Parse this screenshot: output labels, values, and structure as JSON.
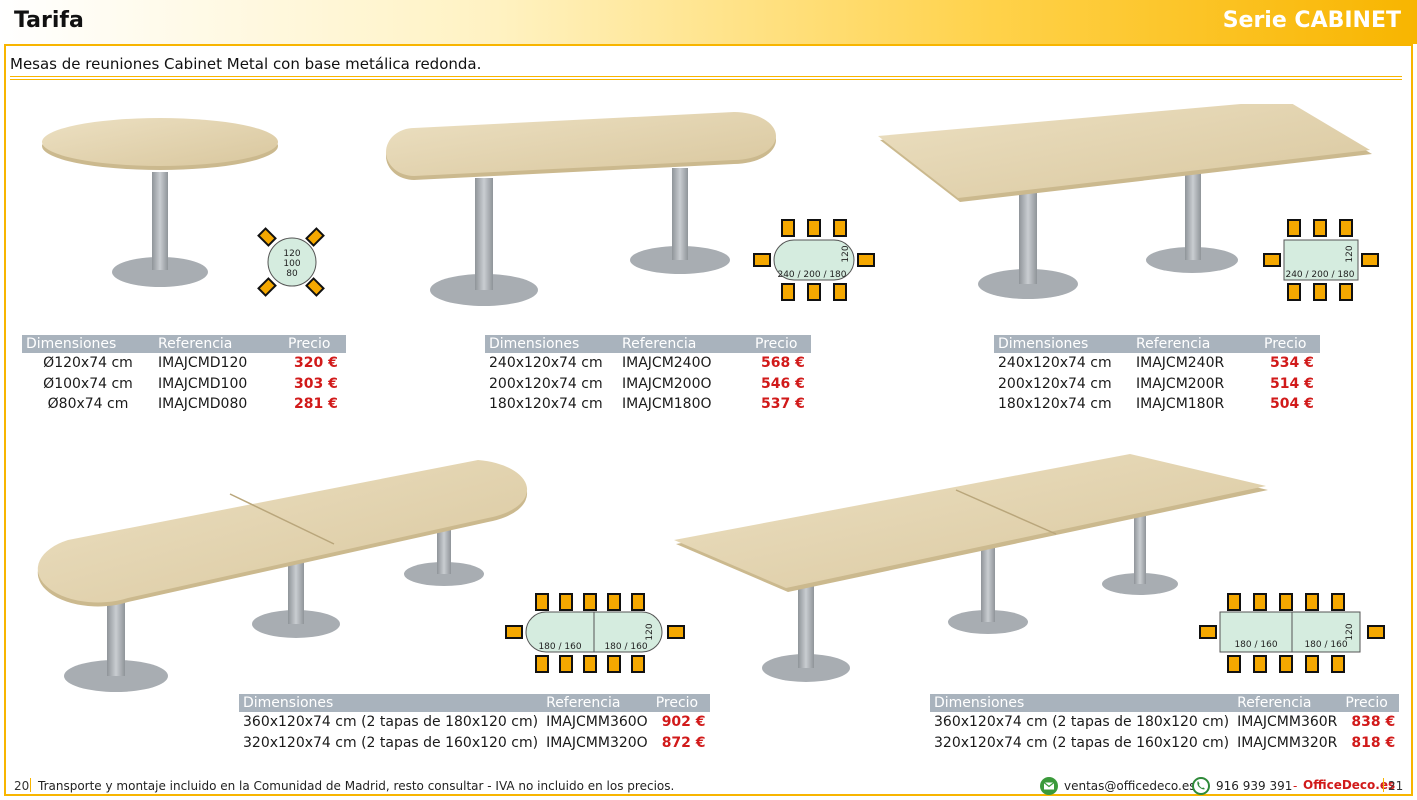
{
  "header": {
    "left_title": "Tarifa",
    "right_title": "Serie CABINET"
  },
  "subtitle": "Mesas de reuniones Cabinet Metal con base metálica redonda.",
  "table_headers": {
    "dim": "Dimensiones",
    "ref": "Referencia",
    "price": "Precio"
  },
  "diagrams": {
    "round": [
      "120",
      "100",
      "80"
    ],
    "oval_dims": "240 / 200 / 180",
    "width": "120",
    "double_oval": [
      "180 / 160",
      "180 / 160"
    ],
    "double_rect": [
      "180 / 160",
      "180 / 160"
    ]
  },
  "products": [
    {
      "name": "round",
      "rows": [
        {
          "dim": "Ø120x74 cm",
          "ref": "IMAJCMD120",
          "price": "320 €"
        },
        {
          "dim": "Ø100x74 cm",
          "ref": "IMAJCMD100",
          "price": "303 €"
        },
        {
          "dim": "Ø80x74 cm",
          "ref": "IMAJCMD080",
          "price": "281 €"
        }
      ]
    },
    {
      "name": "oval",
      "rows": [
        {
          "dim": "240x120x74 cm",
          "ref": "IMAJCM240O",
          "price": "568 €"
        },
        {
          "dim": "200x120x74 cm",
          "ref": "IMAJCM200O",
          "price": "546 €"
        },
        {
          "dim": "180x120x74 cm",
          "ref": "IMAJCM180O",
          "price": "537 €"
        }
      ]
    },
    {
      "name": "rect",
      "rows": [
        {
          "dim": "240x120x74 cm",
          "ref": "IMAJCM240R",
          "price": "534 €"
        },
        {
          "dim": "200x120x74 cm",
          "ref": "IMAJCM200R",
          "price": "514 €"
        },
        {
          "dim": "180x120x74 cm",
          "ref": "IMAJCM180R",
          "price": "504 €"
        }
      ]
    },
    {
      "name": "double-oval",
      "rows": [
        {
          "dim": "360x120x74 cm (2 tapas de 180x120 cm)",
          "ref": "IMAJCMM360O",
          "price": "902 €"
        },
        {
          "dim": "320x120x74 cm (2 tapas de 160x120 cm)",
          "ref": "IMAJCMM320O",
          "price": "872 €"
        }
      ]
    },
    {
      "name": "double-rect",
      "rows": [
        {
          "dim": "360x120x74 cm (2 tapas de 180x120 cm)",
          "ref": "IMAJCMM360R",
          "price": "838 €"
        },
        {
          "dim": "320x120x74 cm (2 tapas de 160x120 cm)",
          "ref": "IMAJCMM320R",
          "price": "818 €"
        }
      ]
    }
  ],
  "footer": {
    "page_left": "20",
    "note": "Transporte y montaje incluido en la Comunidad de Madrid, resto consultar - IVA no incluido en los precios.",
    "email": "ventas@officedeco.es",
    "phone": "916 939 391",
    "dash": "-",
    "brand": "OfficeDeco.es",
    "page_right": "21",
    "icons": {
      "mail": "mail-icon",
      "phone": "phone-icon"
    }
  },
  "colors": {
    "accent": "#f8b500",
    "price": "#d11a1a",
    "table_header": "#a9b3bd",
    "wood": "#e6d7b4",
    "chair": "#f5a800",
    "diagram_table": "#d5ecdf"
  }
}
